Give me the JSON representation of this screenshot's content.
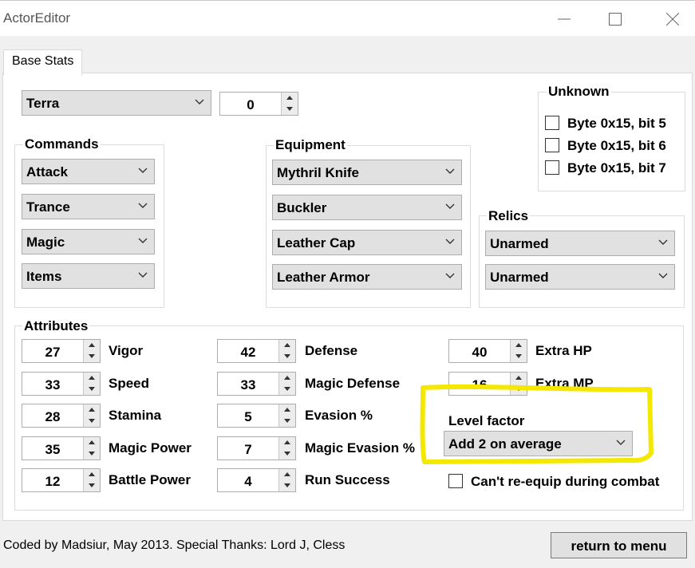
{
  "window": {
    "title": "ActorEditor"
  },
  "tabs": [
    {
      "label": "Base Stats"
    }
  ],
  "character": {
    "name": "Terra",
    "index": "0"
  },
  "unknown": {
    "title": "Unknown",
    "bits": [
      {
        "label": "Byte 0x15, bit 5"
      },
      {
        "label": "Byte 0x15, bit 6"
      },
      {
        "label": "Byte 0x15, bit 7"
      }
    ]
  },
  "commands": {
    "title": "Commands",
    "items": [
      "Attack",
      "Trance",
      "Magic",
      "Items"
    ]
  },
  "equipment": {
    "title": "Equipment",
    "items": [
      "Mythril Knife",
      "Buckler",
      "Leather Cap",
      "Leather Armor"
    ]
  },
  "relics": {
    "title": "Relics",
    "items": [
      "Unarmed",
      "Unarmed"
    ]
  },
  "attributes": {
    "title": "Attributes",
    "col1": [
      {
        "value": "27",
        "label": "Vigor"
      },
      {
        "value": "33",
        "label": "Speed"
      },
      {
        "value": "28",
        "label": "Stamina"
      },
      {
        "value": "35",
        "label": "Magic Power"
      },
      {
        "value": "12",
        "label": "Battle Power"
      }
    ],
    "col2": [
      {
        "value": "42",
        "label": "Defense"
      },
      {
        "value": "33",
        "label": "Magic Defense"
      },
      {
        "value": "5",
        "label": "Evasion %"
      },
      {
        "value": "7",
        "label": "Magic Evasion %"
      },
      {
        "value": "4",
        "label": "Run Success"
      }
    ],
    "col3": [
      {
        "value": "40",
        "label": "Extra HP"
      },
      {
        "value": "16",
        "label": "Extra MP"
      }
    ],
    "level_factor": {
      "label": "Level factor",
      "value": "Add 2 on average"
    },
    "reequip": {
      "label": "Can't re-equip during combat"
    }
  },
  "footer": {
    "credits": "Coded by Madsiur, May 2013. Special Thanks:  Lord J,  Cless",
    "return_label": "return to menu"
  },
  "colors": {
    "highlight": "#f5e800",
    "control": "#e1e1e1",
    "window": "#f0f0f0"
  }
}
